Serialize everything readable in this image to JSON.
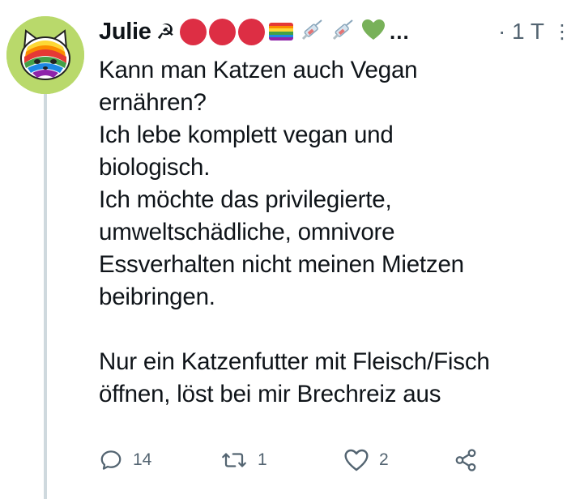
{
  "tweet": {
    "author_name": "Julie",
    "timestamp": "1 T",
    "timestamp_sep": "·",
    "more_glyph": "⋮",
    "ellipsis": "…",
    "text": "Kann man Katzen auch Vegan\nernähren?\nIch lebe komplett vegan und\nbiologisch.\nIch möchte das privilegierte,\numweltschädliche, omnivore\nEssverhalten nicht meinen Mietzen\nbeibringen.\n\nNur ein Katzenfutter mit Fleisch/Fisch\nöffnen, löst bei mir Brechreiz aus"
  },
  "name_emojis": {
    "hammer": "☭",
    "icons": [
      "red-circle-icon",
      "red-circle-icon",
      "red-circle-icon",
      "rainbow-flag-icon",
      "syringe-icon",
      "syringe-icon",
      "green-heart-icon"
    ]
  },
  "actions": {
    "replies": "14",
    "retweets": "1",
    "likes": "2"
  },
  "colors": {
    "text": "#0f1419",
    "muted": "#536471",
    "thread_line": "#cfd9de",
    "avatar_bg": "#b9d96b",
    "red_dot": "#dd2e44",
    "green_heart": "#78b159"
  }
}
